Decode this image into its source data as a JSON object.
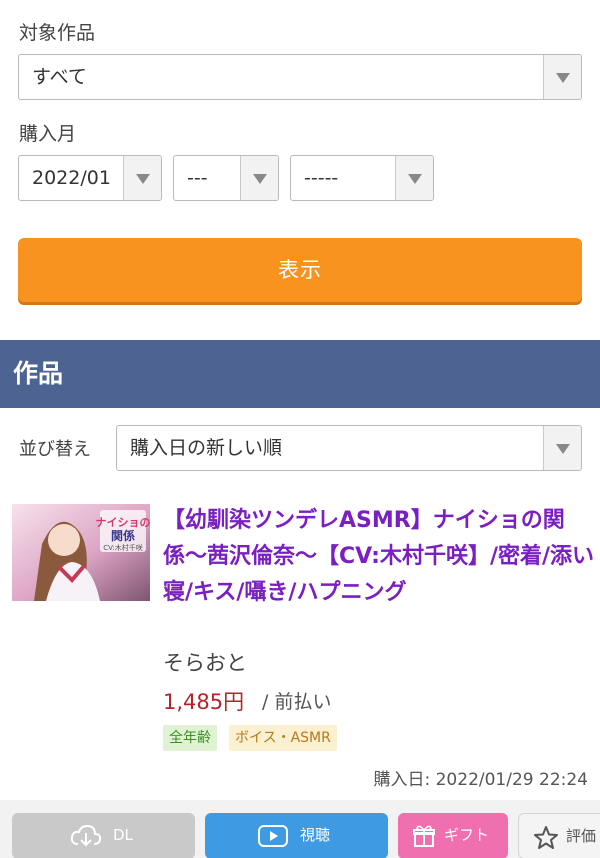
{
  "filters": {
    "target_label": "対象作品",
    "target_value": "すべて",
    "month_label": "購入月",
    "month_value": "2022/01",
    "day_value": "---",
    "extra_value": "-----",
    "show_button": "表示"
  },
  "section": {
    "title": "作品",
    "sort_label": "並び替え",
    "sort_value": "購入日の新しい順"
  },
  "item": {
    "thumbnail_overlay": [
      "ナイショの",
      "関係",
      "CV:木村千咲"
    ],
    "title": "【幼馴染ツンデレASMR】ナイショの関係〜茜沢倫奈〜【CV:木村千咲】/密着/添い寝/キス/囁き/ハプニング",
    "maker": "そらおと",
    "price": "1,485円",
    "payment": "/ 前払い",
    "tags": [
      "全年齢",
      "ボイス・ASMR"
    ],
    "purchase_date": "購入日: 2022/01/29 22:24"
  },
  "actions": {
    "dl": "DL",
    "view": "視聴",
    "gift": "ギフト",
    "review": "評価"
  },
  "colors": {
    "accent_orange": "#f7931e",
    "section_bar": "#4d6391",
    "title_purple": "#7a1fc2",
    "price_red": "#b2262b"
  }
}
